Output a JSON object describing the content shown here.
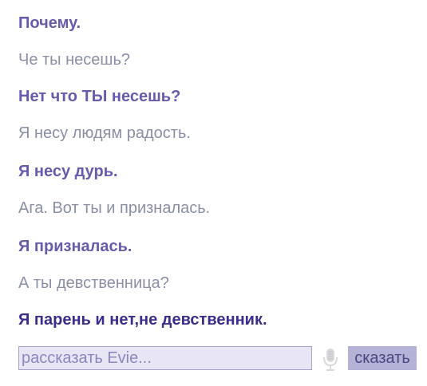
{
  "conversation": [
    {
      "speaker": "user",
      "text": "Почему."
    },
    {
      "speaker": "bot",
      "text": "Че ты несешь?"
    },
    {
      "speaker": "user",
      "text": "Нет что ТЫ несешь?"
    },
    {
      "speaker": "bot",
      "text": "Я несу людям радость."
    },
    {
      "speaker": "user",
      "text": "Я несу дурь."
    },
    {
      "speaker": "bot",
      "text": "Ага. Вот ты и призналась."
    },
    {
      "speaker": "user",
      "text": "Я призналась."
    },
    {
      "speaker": "bot",
      "text": "А ты девственница?"
    },
    {
      "speaker": "user",
      "text": "Я парень и нет,не девственник."
    }
  ],
  "input": {
    "placeholder": "рассказать Evie...",
    "value": ""
  },
  "mic_icon": "microphone-icon",
  "send_label": "сказать",
  "colors": {
    "user_text": "#6a5aad",
    "user_last_text": "#3d2c8c",
    "bot_text": "#8b8fa6",
    "input_bg": "#e8e6f5",
    "input_border": "#a7a3c9",
    "button_bg": "#b5b2d8"
  }
}
